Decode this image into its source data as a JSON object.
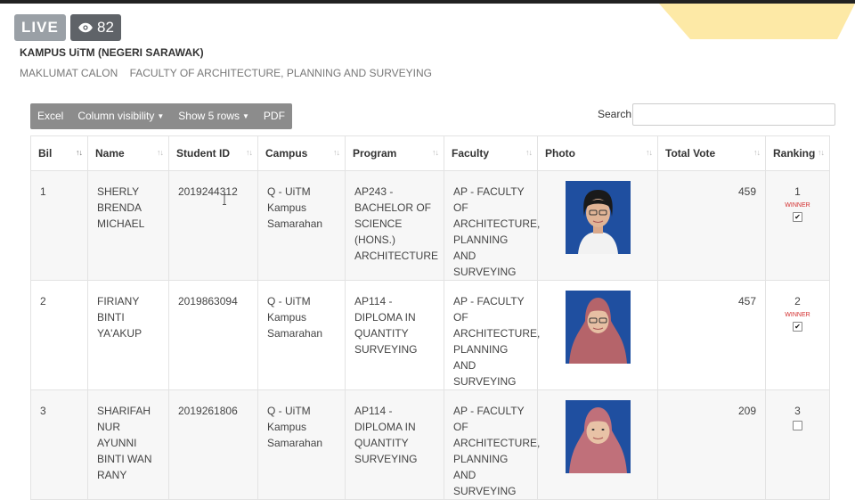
{
  "live": {
    "label": "LIVE",
    "viewers": "82"
  },
  "header": {
    "campus": "KAMPUS UiTM (NEGERI SARAWAK)",
    "section": "MAKLUMAT CALON",
    "faculty": "FACULTY OF ARCHITECTURE, PLANNING AND SURVEYING"
  },
  "toolbar": {
    "excel": "Excel",
    "column_visibility": "Column visibility",
    "show_rows": "Show 5 rows",
    "pdf": "PDF",
    "search_label": "Search:",
    "search_value": ""
  },
  "table": {
    "headers": [
      "Bil",
      "Name",
      "Student ID",
      "Campus",
      "Program",
      "Faculty",
      "Photo",
      "Total Vote",
      "Ranking"
    ],
    "rows": [
      {
        "bil": "1",
        "name": "SHERLY BRENDA MICHAEL",
        "student_id": "2019244312",
        "campus": "Q - UiTM Kampus Samarahan",
        "program": "AP243 - BACHELOR OF SCIENCE (HONS.) ARCHITECTURE",
        "faculty": "AP - FACULTY OF ARCHITECTURE, PLANNING AND SURVEYING",
        "total_vote": "459",
        "ranking": "1",
        "status": "WINNER",
        "checked": true
      },
      {
        "bil": "2",
        "name": "FIRIANY BINTI YA'AKUP",
        "student_id": "2019863094",
        "campus": "Q - UiTM Kampus Samarahan",
        "program": "AP114 - DIPLOMA IN QUANTITY SURVEYING",
        "faculty": "AP - FACULTY OF ARCHITECTURE, PLANNING AND SURVEYING",
        "total_vote": "457",
        "ranking": "2",
        "status": "WINNER",
        "checked": true
      },
      {
        "bil": "3",
        "name": "SHARIFAH NUR AYUNNI BINTI WAN RANY",
        "student_id": "2019261806",
        "campus": "Q - UiTM Kampus Samarahan",
        "program": "AP114 - DIPLOMA IN QUANTITY SURVEYING",
        "faculty": "AP - FACULTY OF ARCHITECTURE, PLANNING AND SURVEYING",
        "total_vote": "209",
        "ranking": "3",
        "status": "",
        "checked": false
      }
    ]
  },
  "icons": {
    "viewer": "eye-icon",
    "sort": "sort-arrows-icon",
    "photo": "candidate-photo",
    "checkbox": "checkbox-icon"
  },
  "colors": {
    "winner": "#d32f2f",
    "button_group": "#8c8c8c",
    "photo_bg": "#1f4fa0",
    "deco_yellow": "#fde9a6",
    "deco_blue": "#c9d6ee"
  }
}
